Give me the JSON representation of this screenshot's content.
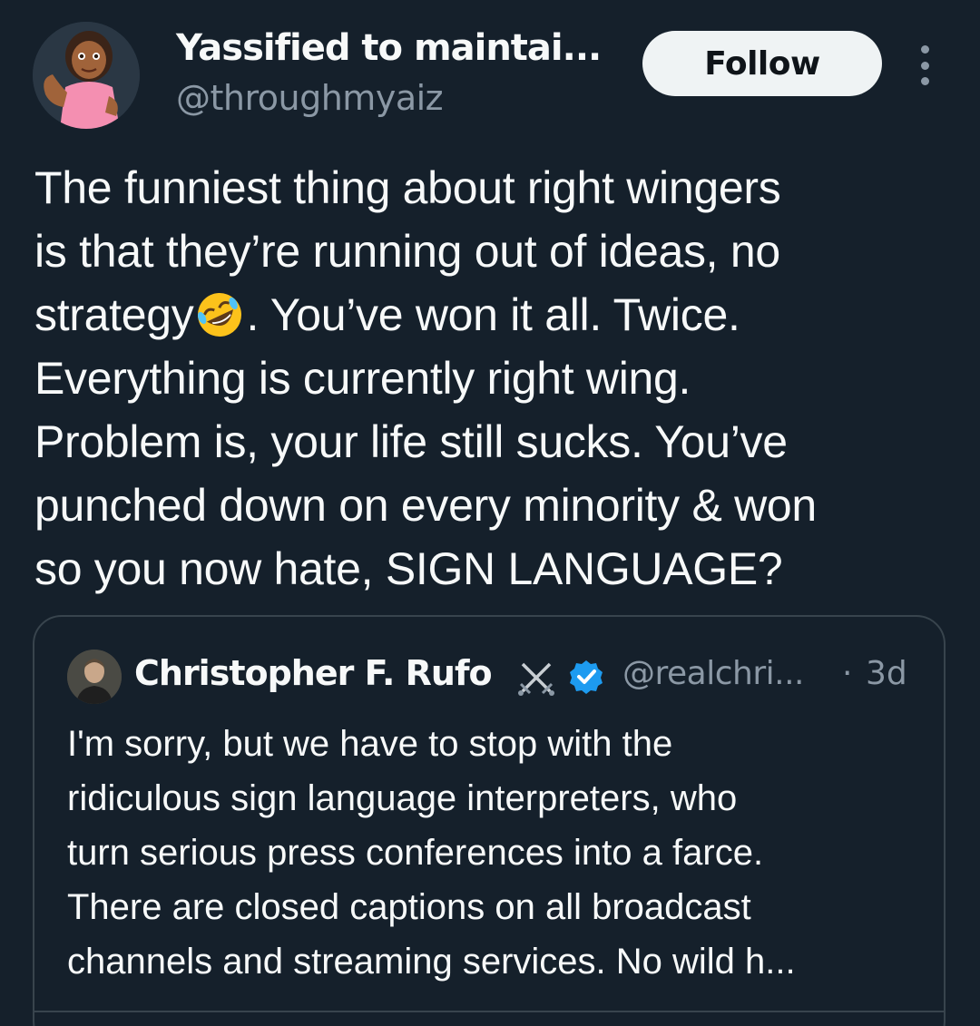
{
  "author": {
    "display_name": "Yassified to maintai...",
    "handle": "@throughmyaiz",
    "avatar_icon": "woman-flexing-emoji-avatar"
  },
  "actions": {
    "follow_label": "Follow",
    "more_icon": "more-vertical-icon"
  },
  "tweet": {
    "lines": [
      "The funniest thing about right wingers",
      "is that they’re running out of ideas, no",
      "strategy",
      ". You’ve won it all. Twice.",
      "Everything is currently right wing.",
      "Problem is, your life still sucks. You’ve",
      "punched down on every minority & won",
      "so you now hate, SIGN LANGUAGE?"
    ],
    "emoji": "rolling-on-floor-laughing-emoji"
  },
  "quoted_tweet": {
    "display_name": "Christopher F. Rufo",
    "handle": "@realchri...",
    "separator": "·",
    "time": "3d",
    "badge_icon": "crossed-swords-icon",
    "verified_icon": "verified-badge-icon",
    "lines": [
      "I'm sorry, but we have to stop with the",
      "ridiculous sign language interpreters, who",
      "turn serious press conferences into a farce.",
      "There are closed captions on all broadcast",
      "channels and streaming services. No wild h..."
    ]
  },
  "colors": {
    "background": "#15202b",
    "text": "#f7f9f9",
    "secondary_text": "#8b98a5",
    "border": "#38444d",
    "verified": "#1d9bf0",
    "button_bg": "#eff3f4"
  }
}
